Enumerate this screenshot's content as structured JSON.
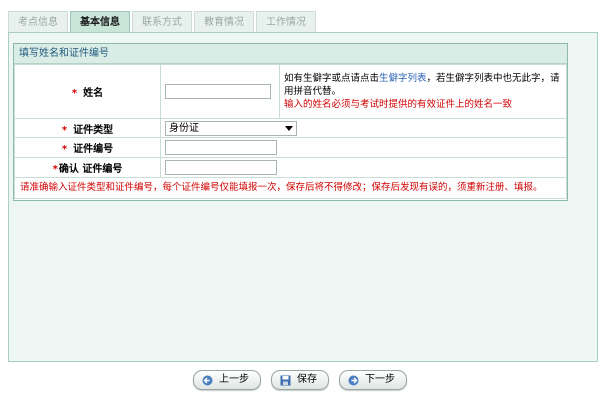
{
  "tabs": [
    {
      "label": "考点信息",
      "active": false
    },
    {
      "label": "基本信息",
      "active": true
    },
    {
      "label": "联系方式",
      "active": false
    },
    {
      "label": "教育情况",
      "active": false
    },
    {
      "label": "工作情况",
      "active": false
    }
  ],
  "form": {
    "title": "填写姓名和证件编号",
    "name_label": "姓名",
    "name_value": "",
    "name_help_pre": "如有生僻字或点请点击",
    "name_help_link": "生僻字列表",
    "name_help_post": "，若生僻字列表中也无此字，请用拼音代替。",
    "name_help_warning": "输入的姓名必须与考试时提供的有效证件上的姓名一致",
    "id_type_label": "证件类型",
    "id_type_value": "身份证",
    "id_number_label": "证件编号",
    "id_number_value": "",
    "confirm_label": "确认 证件编号",
    "confirm_value": "",
    "required_mark": "*",
    "note": "请准确输入证件类型和证件编号，每个证件编号仅能填报一次，保存后将不得修改；保存后发现有误的，须重新注册、填报。"
  },
  "buttons": {
    "prev": "上一步",
    "save": "保存",
    "next": "下一步"
  },
  "colors": {
    "accent": "#245b7e",
    "required": "#d10000",
    "link": "#2b63b5"
  }
}
